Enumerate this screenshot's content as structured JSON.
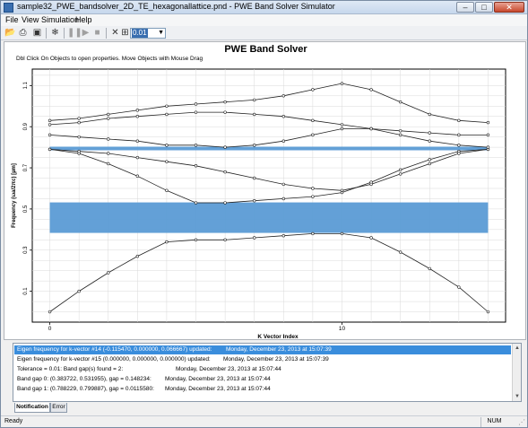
{
  "window": {
    "title": "sample32_PWE_bandsolver_2D_TE_hexagonallattice.pnd - PWE Band Solver Simulator",
    "buttons": {
      "minimize": "–",
      "maximize": "□",
      "close": "✕"
    }
  },
  "menu": [
    "File",
    "View",
    "Simulation",
    "Help"
  ],
  "toolbar": {
    "icons": [
      "open-icon",
      "print-icon",
      "save-icon",
      "bulb-icon",
      "pause-icon",
      "play-icon",
      "stop-icon",
      "close-icon",
      "zoom-icon"
    ],
    "zoom_value": "0.01"
  },
  "chart": {
    "title": "PWE Band Solver",
    "hint": "Dbl Click On Objects to open properties.  Move Objects with Mouse Drag"
  },
  "chart_data": {
    "type": "line",
    "xlabel": "K Vector Index",
    "ylabel": "Frequency (ωa/2πc) [µm]",
    "xlim": [
      -0.6,
      15.6
    ],
    "ylim": [
      -0.05,
      1.18
    ],
    "x_ticks": [
      0,
      10
    ],
    "y_ticks": [
      0.1,
      0.3,
      0.5,
      0.7,
      0.9,
      1.1
    ],
    "x_tick_labels": [
      "0",
      "10"
    ],
    "y_tick_labels": [
      "0.1",
      "0.3",
      "0.5",
      "0.7",
      "0.9",
      "1.1"
    ],
    "grid": true,
    "legend": "none",
    "band_color": "#5b9bd5",
    "line_color": "#222222",
    "x": [
      0,
      1,
      2,
      3,
      4,
      5,
      6,
      7,
      8,
      9,
      10,
      11,
      12,
      13,
      14,
      15
    ],
    "band_gaps": [
      {
        "low": 0.383722,
        "high": 0.531955
      },
      {
        "low": 0.788229,
        "high": 0.799887
      }
    ],
    "series": [
      {
        "values": [
          0.0,
          0.1,
          0.19,
          0.27,
          0.34,
          0.35,
          0.35,
          0.36,
          0.37,
          0.38,
          0.38,
          0.36,
          0.29,
          0.21,
          0.12,
          0.0
        ]
      },
      {
        "values": [
          0.79,
          0.77,
          0.72,
          0.66,
          0.59,
          0.53,
          0.53,
          0.54,
          0.55,
          0.56,
          0.58,
          0.63,
          0.69,
          0.74,
          0.78,
          0.79
        ]
      },
      {
        "values": [
          0.79,
          0.78,
          0.77,
          0.75,
          0.73,
          0.71,
          0.68,
          0.65,
          0.62,
          0.6,
          0.59,
          0.62,
          0.67,
          0.72,
          0.77,
          0.79
        ]
      },
      {
        "values": [
          0.86,
          0.85,
          0.84,
          0.83,
          0.81,
          0.81,
          0.8,
          0.81,
          0.83,
          0.86,
          0.89,
          0.89,
          0.88,
          0.87,
          0.86,
          0.86
        ]
      },
      {
        "values": [
          0.93,
          0.94,
          0.96,
          0.98,
          1.0,
          1.01,
          1.02,
          1.03,
          1.05,
          1.08,
          1.11,
          1.08,
          1.02,
          0.96,
          0.93,
          0.92
        ]
      },
      {
        "values": [
          0.91,
          0.92,
          0.94,
          0.95,
          0.96,
          0.97,
          0.97,
          0.96,
          0.95,
          0.93,
          0.91,
          0.89,
          0.86,
          0.83,
          0.81,
          0.8
        ]
      }
    ]
  },
  "log": {
    "rows": [
      {
        "text": "Eigen frequency for k-vector #14 (-0.115470, 0.000000, 0.066667) updated:",
        "time": "Monday, December 23, 2013 at 15:07:39",
        "selected": true
      },
      {
        "text": "Eigen frequency for k-vector #15 (0.000000, 0.000000, 0.000000) updated:",
        "time": "Monday, December 23, 2013 at 15:07:39",
        "selected": false
      },
      {
        "text": "Tolerance = 0.01: Band gap(s) found = 2:",
        "time": "Monday, December 23, 2013 at 15:07:44",
        "selected": false
      },
      {
        "text": "Band gap 0: (0.383722, 0.531955), gap = 0.148234:",
        "time": "Monday, December 23, 2013 at 15:07:44",
        "selected": false
      },
      {
        "text": "Band gap 1: (0.788229, 0.799887), gap = 0.0115580:",
        "time": "Monday, December 23, 2013 at 15:07:44",
        "selected": false
      }
    ],
    "tabs": [
      "Notification",
      "Error"
    ]
  },
  "status": {
    "text": "Ready",
    "indicator": "NUM"
  }
}
